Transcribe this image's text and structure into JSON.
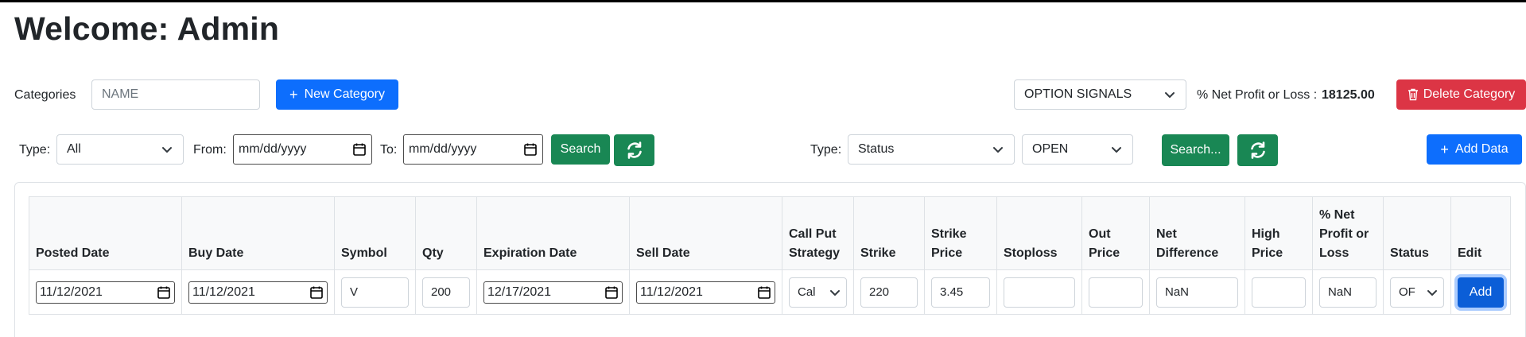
{
  "header": {
    "title": "Welcome: Admin"
  },
  "category_bar": {
    "label": "Categories",
    "name_placeholder": "NAME",
    "new_category_label": "New Category",
    "selected_category": "OPTION SIGNALS",
    "net_label": "% Net Profit or Loss :",
    "net_value": "18125.00",
    "delete_label": "Delete Category"
  },
  "filter_left": {
    "type_label": "Type:",
    "type_value": "All",
    "from_label": "From:",
    "from_value": "mm/dd/yyyy",
    "to_label": "To:",
    "to_value": "mm/dd/yyyy",
    "search_label": "Search"
  },
  "filter_right": {
    "type_label": "Type:",
    "type_value": "Status",
    "status_value": "OPEN",
    "search_label": "Search...",
    "add_data_label": "Add Data"
  },
  "table": {
    "headers": [
      "Posted Date",
      "Buy Date",
      "Symbol",
      "Qty",
      "Expiration Date",
      "Sell Date",
      "Call Put Strategy",
      "Strike",
      "Strike Price",
      "Stoploss",
      "Out Price",
      "Net Difference",
      "High Price",
      "% Net Profit or Loss",
      "Status",
      "Edit"
    ],
    "row": {
      "posted_date": "11/12/2021",
      "buy_date": "11/12/2021",
      "symbol": "V",
      "qty": "200",
      "expiration_date": "12/17/2021",
      "sell_date": "11/12/2021",
      "strategy": "Cal",
      "strike": "220",
      "strike_price": "3.45",
      "stoploss": "",
      "out_price": "",
      "net_difference": "NaN",
      "high_price": "",
      "net_profit": "NaN",
      "status": "OF",
      "edit_label": "Add"
    }
  },
  "colors": {
    "primary": "#0d6efd",
    "success": "#198754",
    "danger": "#dc3545"
  },
  "icons": [
    "plus-icon",
    "trash-icon",
    "calendar-icon",
    "refresh-icon",
    "chevron-down-icon"
  ]
}
